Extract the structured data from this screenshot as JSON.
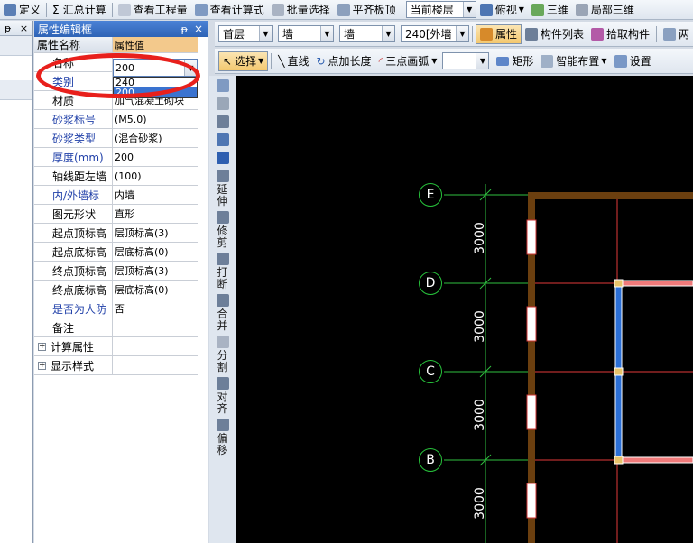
{
  "toolbar": {
    "items": [
      {
        "label": "定义",
        "icon": "define-icon"
      },
      {
        "label": "汇总计算",
        "icon": "sigma-icon",
        "prefix": "Σ"
      },
      {
        "label": "查看工程量",
        "icon": "view-quantity-icon"
      },
      {
        "label": "查看计算式",
        "icon": "view-formula-icon"
      },
      {
        "label": "批量选择",
        "icon": "batch-select-icon"
      },
      {
        "label": "平齐板顶",
        "icon": "align-slab-top-icon"
      }
    ],
    "floor_combo": "当前楼层",
    "view_items": [
      {
        "label": "俯视",
        "icon": "top-view-icon"
      },
      {
        "label": "三维",
        "icon": "3d-view-icon"
      },
      {
        "label": "局部三维",
        "icon": "partial-3d-icon"
      }
    ]
  },
  "left_strip": {
    "pin": "ᵽ",
    "close": "×"
  },
  "panel": {
    "title": "属性编辑框",
    "pin": "ᵽ",
    "close": "×",
    "header": {
      "name": "属性名称",
      "value": "属性值"
    },
    "rows": [
      {
        "name": "名称",
        "value": "200",
        "blue": false
      },
      {
        "name": "类别",
        "value": "",
        "blue": true
      },
      {
        "name": "材质",
        "value": "加气混凝土砌块",
        "blue": false
      },
      {
        "name": "砂浆标号",
        "value": "(M5.0)",
        "blue": true
      },
      {
        "name": "砂浆类型",
        "value": "(混合砂浆)",
        "blue": true
      },
      {
        "name": "厚度(mm)",
        "value": "200",
        "blue": true
      },
      {
        "name": "轴线距左墙",
        "value": "(100)",
        "blue": false
      },
      {
        "name": "内/外墙标",
        "value": "内墙",
        "blue": true
      },
      {
        "name": "图元形状",
        "value": "直形",
        "blue": false
      },
      {
        "name": "起点顶标高",
        "value": "层顶标高(3)",
        "blue": false
      },
      {
        "name": "起点底标高",
        "value": "层底标高(0)",
        "blue": false
      },
      {
        "name": "终点顶标高",
        "value": "层顶标高(3)",
        "blue": false
      },
      {
        "name": "终点底标高",
        "value": "层底标高(0)",
        "blue": false
      },
      {
        "name": "是否为人防",
        "value": "否",
        "blue": true
      },
      {
        "name": "备注",
        "value": "",
        "blue": false
      }
    ],
    "groups": [
      "计算属性",
      "显示样式"
    ],
    "plus": "+",
    "edit_value": "200",
    "dropdown_options": [
      "240",
      "200"
    ]
  },
  "toolbar2": {
    "floor": "首层",
    "type1": "墙",
    "type2": "墙",
    "spec": "240[外墙",
    "buttons": [
      "属性",
      "构件列表",
      "拾取构件"
    ],
    "more": "两"
  },
  "toolbar3": {
    "select": "选择",
    "line": "直线",
    "point_len": "点加长度",
    "arc": "三点画弧",
    "rect": "矩形",
    "smart": "智能布置",
    "settings": "设置"
  },
  "vtools": [
    {
      "label": "",
      "icon": "pen-icon"
    },
    {
      "label": "",
      "icon": "copy-icon"
    },
    {
      "label": "",
      "icon": "mirror-icon"
    },
    {
      "label": "",
      "icon": "move-icon"
    },
    {
      "label": "",
      "icon": "rotate-icon"
    },
    {
      "label": "延伸",
      "icon": "extend-icon"
    },
    {
      "label": "修剪",
      "icon": "trim-icon"
    },
    {
      "label": "打断",
      "icon": "break-icon"
    },
    {
      "label": "合并",
      "icon": "merge-icon"
    },
    {
      "label": "分割",
      "icon": "split-icon"
    },
    {
      "label": "对齐",
      "icon": "align-icon"
    },
    {
      "label": "偏移",
      "icon": "offset-icon"
    }
  ],
  "canvas": {
    "axes": [
      "E",
      "D",
      "C",
      "B"
    ],
    "dims": [
      "3000",
      "3000",
      "3000",
      "3000"
    ]
  }
}
